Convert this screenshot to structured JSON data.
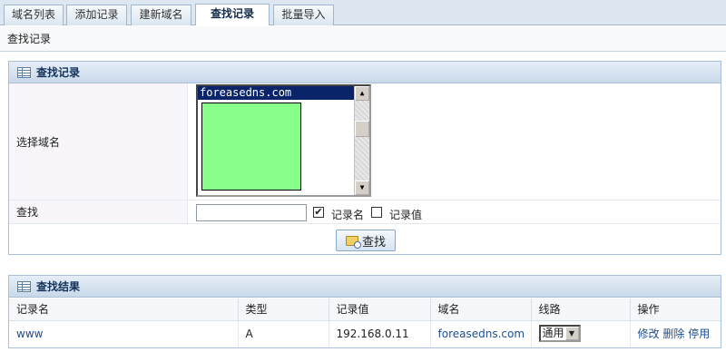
{
  "tabs": [
    {
      "label": "域名列表"
    },
    {
      "label": "添加记录"
    },
    {
      "label": "建新域名"
    },
    {
      "label": "查找记录"
    },
    {
      "label": "批量导入"
    }
  ],
  "active_tab_index": 3,
  "page_title": "查找记录",
  "search_panel": {
    "title": "查找记录",
    "domain_label": "选择域名",
    "domain_options": [
      "foreasedns.com"
    ],
    "selected_domain": "foreasedns.com",
    "search_label": "查找",
    "search_value": "",
    "checkbox_name_label": "记录名",
    "checkbox_name_checked": true,
    "checkbox_value_label": "记录值",
    "checkbox_value_checked": false,
    "search_button_label": "查找"
  },
  "results_panel": {
    "title": "查找结果",
    "columns": [
      "记录名",
      "类型",
      "记录值",
      "域名",
      "线路",
      "操作"
    ],
    "rows": [
      {
        "name": "www",
        "type": "A",
        "value": "192.168.0.11",
        "domain": "foreasedns.com",
        "line": "通用",
        "actions": [
          "修改",
          "删除",
          "停用"
        ]
      }
    ]
  }
}
